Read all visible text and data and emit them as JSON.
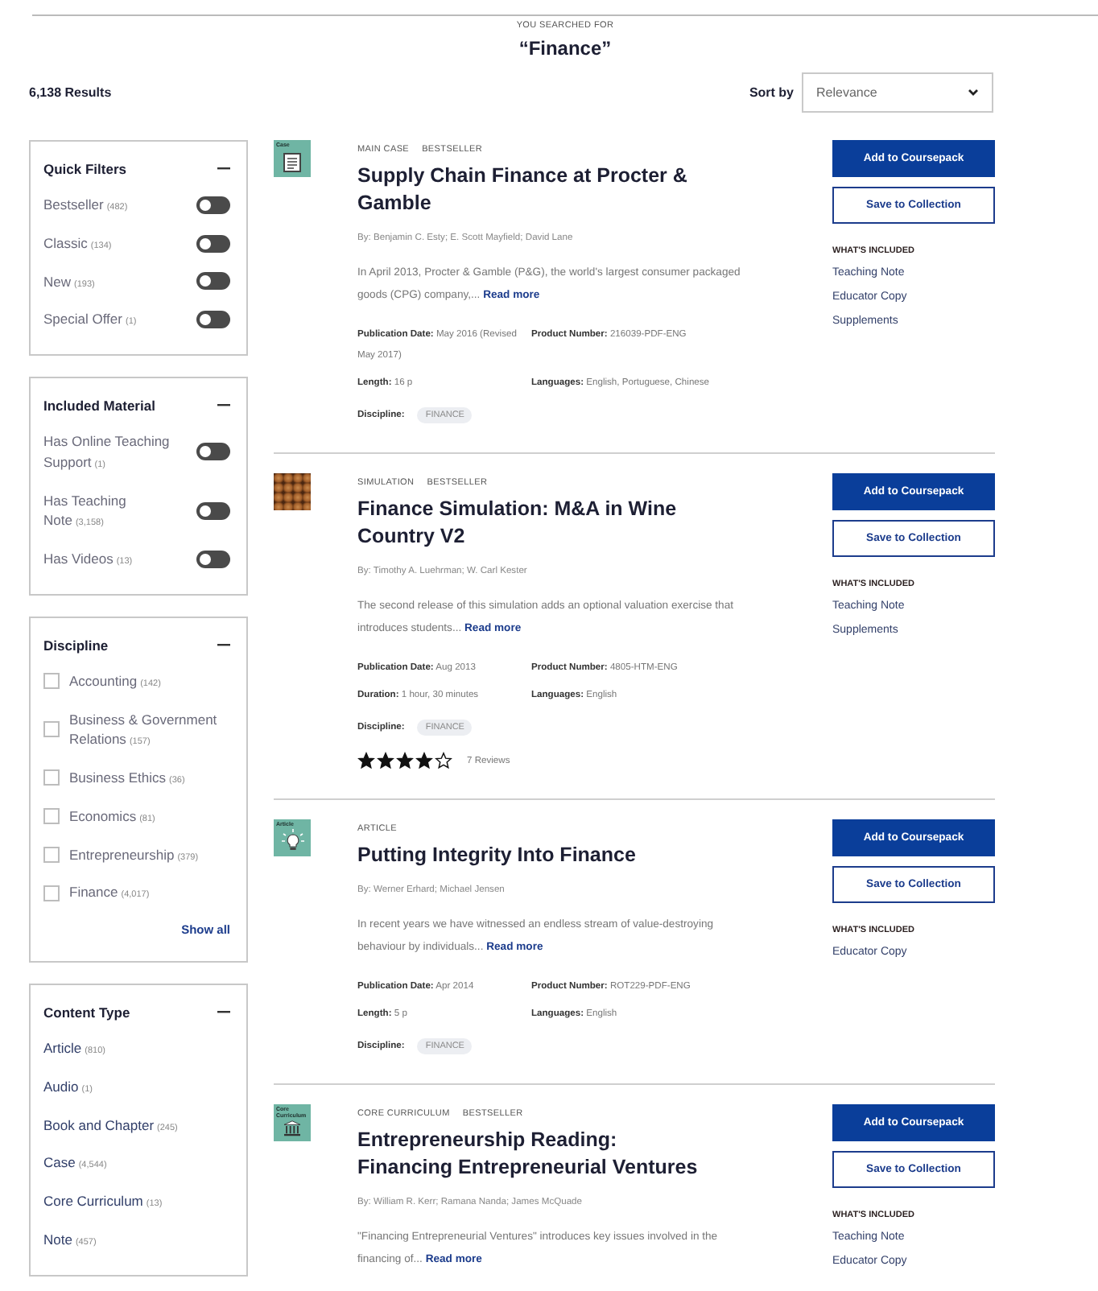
{
  "search": {
    "prompt": "YOU SEARCHED FOR",
    "query": "“Finance”"
  },
  "results_count": "6,138 Results",
  "sort": {
    "label": "Sort by",
    "value": "Relevance"
  },
  "filters": [
    {
      "kind": "toggle",
      "title": "Quick Filters",
      "items": [
        {
          "label": "Bestseller",
          "count": "(482)",
          "on": false
        },
        {
          "label": "Classic",
          "count": "(134)",
          "on": false
        },
        {
          "label": "New",
          "count": "(193)",
          "on": false
        },
        {
          "label": "Special Offer",
          "count": "(1)",
          "on": false
        }
      ]
    },
    {
      "kind": "toggle",
      "title": "Included Material",
      "items": [
        {
          "label": "Has Online Teaching Support",
          "count": "(1)",
          "on": false
        },
        {
          "label": "Has Teaching Note",
          "count": "(3,158)",
          "on": false
        },
        {
          "label": "Has Videos",
          "count": "(13)",
          "on": false
        }
      ]
    },
    {
      "kind": "checkbox",
      "title": "Discipline",
      "items": [
        {
          "label": "Accounting",
          "count": "(142)",
          "checked": false
        },
        {
          "label": "Business & Government Relations",
          "count": "(157)",
          "checked": false
        },
        {
          "label": "Business Ethics",
          "count": "(36)",
          "checked": false
        },
        {
          "label": "Economics",
          "count": "(81)",
          "checked": false
        },
        {
          "label": "Entrepreneurship",
          "count": "(379)",
          "checked": false
        },
        {
          "label": "Finance",
          "count": "(4,017)",
          "checked": false
        }
      ],
      "show_all": "Show all"
    },
    {
      "kind": "link",
      "title": "Content Type",
      "items": [
        {
          "label": "Article",
          "count": "(810)"
        },
        {
          "label": "Audio",
          "count": "(1)"
        },
        {
          "label": "Book and Chapter",
          "count": "(245)"
        },
        {
          "label": "Case",
          "count": "(4,544)"
        },
        {
          "label": "Core Curriculum",
          "count": "(13)"
        },
        {
          "label": "Note",
          "count": "(457)"
        }
      ]
    }
  ],
  "results": [
    {
      "thumb": {
        "kind": "case",
        "label": "Case"
      },
      "tags": [
        "MAIN CASE",
        "BESTSELLER"
      ],
      "title": "Supply Chain Finance at Procter & Gamble",
      "authors": "By: Benjamin C. Esty; E. Scott Mayfield; David Lane",
      "summary": "In April 2013, Procter & Gamble (P&G), the world's largest consumer packaged goods (CPG) company,...",
      "read_more": "Read more",
      "meta": [
        "**Publication Date:** May 2016 (Revised May 2017)",
        "**Product Number:** 216039-PDF-ENG",
        "**Length:** 16 p",
        "**Languages:** English, Portuguese, Chinese"
      ],
      "discipline": {
        "label": "Discipline:",
        "tag": "FINANCE"
      },
      "actions": [
        "Add to Coursepack",
        "Save to Collection"
      ],
      "included": {
        "heading": "WHAT'S INCLUDED",
        "items": [
          "Teaching Note",
          "Educator Copy",
          "Supplements"
        ]
      }
    },
    {
      "thumb": {
        "kind": "photo"
      },
      "tags": [
        "SIMULATION",
        "BESTSELLER"
      ],
      "title": "Finance Simulation: M&A in Wine Country V2",
      "authors": "By: Timothy A. Luehrman; W. Carl Kester",
      "summary": "The second release of this simulation adds an optional valuation exercise that introduces students...",
      "read_more": "Read more",
      "meta": [
        "**Publication Date:** Aug 2013",
        "**Product Number:** 4805-HTM-ENG",
        "**Duration:** 1 hour, 30 minutes",
        "**Languages:** English"
      ],
      "discipline": {
        "label": "Discipline:",
        "tag": "FINANCE"
      },
      "rating": {
        "stars": 4,
        "reviews": "7 Reviews"
      },
      "actions": [
        "Add to Coursepack",
        "Save to Collection"
      ],
      "included": {
        "heading": "WHAT'S INCLUDED",
        "items": [
          "Teaching Note",
          "Supplements"
        ]
      }
    },
    {
      "thumb": {
        "kind": "article",
        "label": "Article"
      },
      "tags": [
        "ARTICLE"
      ],
      "title": "Putting Integrity Into Finance",
      "authors": "By: Werner Erhard; Michael Jensen",
      "summary": "In recent years we have witnessed an endless stream of value-destroying behaviour by individuals...",
      "read_more": "Read more",
      "meta": [
        "**Publication Date:** Apr 2014",
        "**Product Number:** ROT229-PDF-ENG",
        "**Length:** 5 p",
        "**Languages:** English"
      ],
      "discipline": {
        "label": "Discipline:",
        "tag": "FINANCE"
      },
      "actions": [
        "Add to Coursepack",
        "Save to Collection"
      ],
      "included": {
        "heading": "WHAT'S INCLUDED",
        "items": [
          "Educator Copy"
        ]
      }
    },
    {
      "thumb": {
        "kind": "curriculum",
        "label": "Core Curriculum"
      },
      "tags": [
        "CORE CURRICULUM",
        "BESTSELLER"
      ],
      "title": "Entrepreneurship Reading: Financing Entrepreneurial Ventures",
      "authors": "By: William R. Kerr; Ramana Nanda; James McQuade",
      "summary": "\"Financing Entrepreneurial Ventures\" introduces key issues involved in the financing of...",
      "read_more": "Read more",
      "actions": [
        "Add to Coursepack",
        "Save to Collection"
      ],
      "included": {
        "heading": "WHAT'S INCLUDED",
        "items": [
          "Teaching Note",
          "Educator Copy"
        ]
      }
    }
  ]
}
